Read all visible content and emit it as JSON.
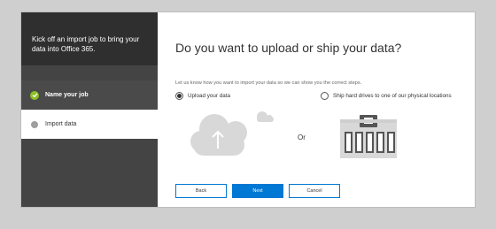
{
  "sidebar": {
    "header": "Kick off an import job to bring your data into Office 365.",
    "steps": [
      {
        "label": "Name your job",
        "state": "completed"
      },
      {
        "label": "Import data",
        "state": "current"
      }
    ]
  },
  "main": {
    "title": "Do you want to upload or ship your data?",
    "instruction": "Let us know how you want to import your data so we can show you the correct steps.",
    "options": [
      {
        "label": "Upload your data",
        "selected": true
      },
      {
        "label": "Ship hard drives to one of our physical locations",
        "selected": false
      }
    ],
    "or_text": "Or",
    "buttons": {
      "back": "Back",
      "next": "Next",
      "cancel": "Cancel"
    }
  },
  "colors": {
    "accent": "#0078d4",
    "sidebar": "#444444",
    "sidebar_header": "#2f2f2f",
    "check_green": "#8cbf26",
    "illustration_gray": "#d8d8d8"
  },
  "icons": [
    "check-icon",
    "step-dot-icon",
    "upload-arrow-icon",
    "cloud-icon",
    "drive-enclosure-icon"
  ]
}
